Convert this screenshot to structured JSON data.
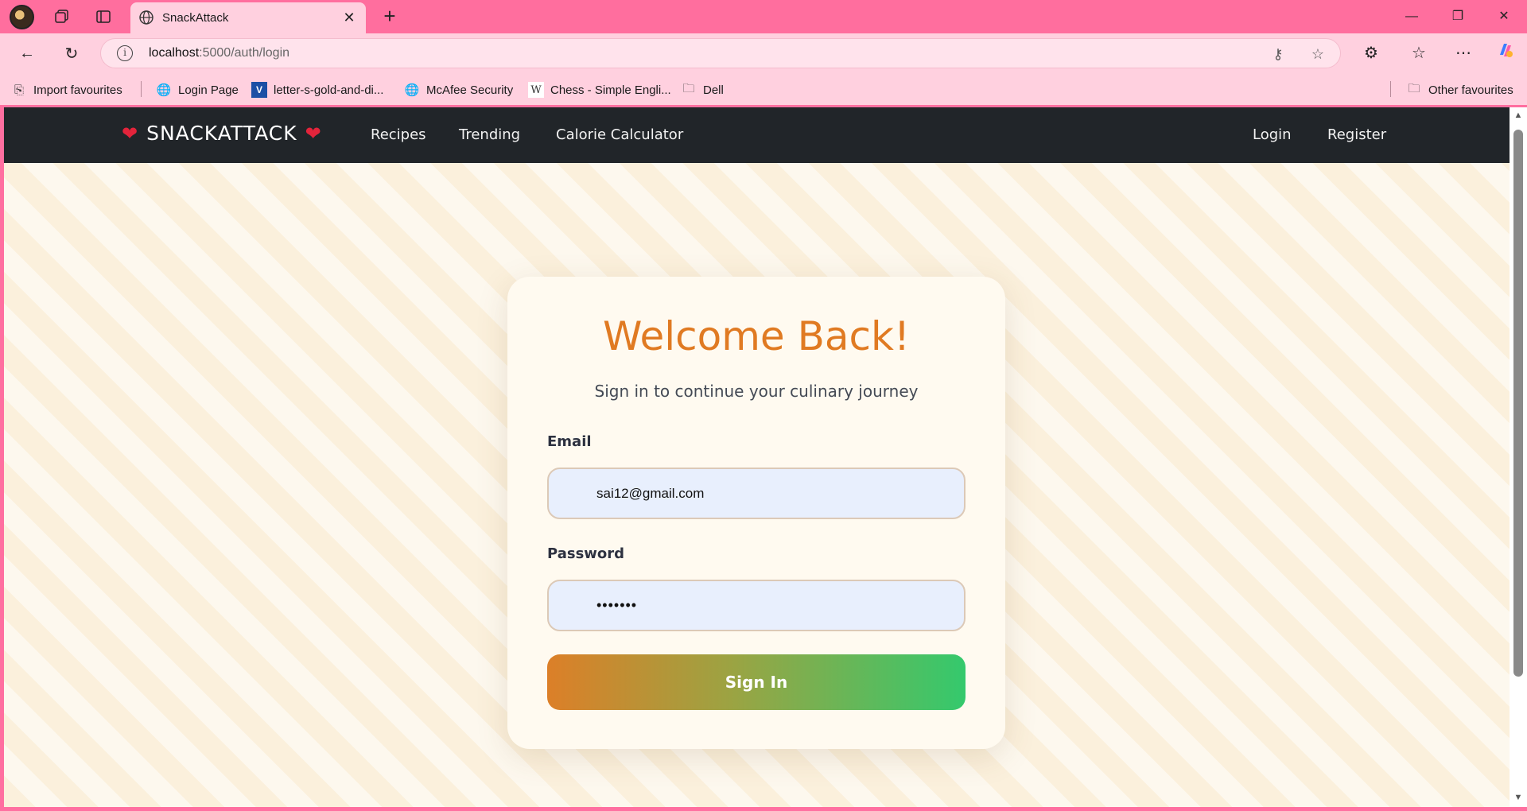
{
  "browser": {
    "tab_title": "SnackAttack",
    "tab_close": "✕",
    "new_tab": "+",
    "url_host": "localhost",
    "url_path": ":5000/auth/login",
    "window_controls": {
      "minimize": "—",
      "restore": "❐",
      "close": "✕"
    },
    "nav": {
      "back": "←",
      "reload": "↻"
    },
    "toolbar_icons": {
      "key": "⚷",
      "favorite": "☆",
      "extensions": "⚙",
      "favorites_bar": "☆",
      "more": "⋯"
    }
  },
  "bookmarks": [
    {
      "label": "Import favourites",
      "icon": "import-icon",
      "glyph": "⎘"
    },
    {
      "label": "Login Page",
      "icon": "globe-icon",
      "glyph": "🌐"
    },
    {
      "label": "letter-s-gold-and-di...",
      "icon": "v-logo-icon",
      "glyph": "V"
    },
    {
      "label": "McAfee Security",
      "icon": "globe-icon",
      "glyph": "🌐"
    },
    {
      "label": "Chess - Simple Engli...",
      "icon": "wikipedia-icon",
      "glyph": "W"
    },
    {
      "label": "Dell",
      "icon": "folder-icon",
      "glyph": "🗀"
    },
    {
      "label": "Other favourites",
      "icon": "folder-icon",
      "glyph": "🗀"
    }
  ],
  "site": {
    "brand": "SNACKATTACK",
    "heart": "❤",
    "nav_links": [
      "Recipes",
      "Trending",
      "Calorie Calculator"
    ],
    "auth_links": [
      "Login",
      "Register"
    ]
  },
  "login": {
    "heading": "Welcome Back!",
    "subtitle": "Sign in to continue your culinary journey",
    "email_label": "Email",
    "email_value": "sai12@gmail.com",
    "password_label": "Password",
    "password_value": "•••••••",
    "submit_label": "Sign In"
  },
  "colors": {
    "browser_frame": "#ff6e9e",
    "browser_toolbar": "#ffd0df",
    "site_nav": "#212529",
    "heading": "#e07a22",
    "button_start": "#dc7f28",
    "button_end": "#34c96d",
    "input_bg": "#e8effd"
  }
}
